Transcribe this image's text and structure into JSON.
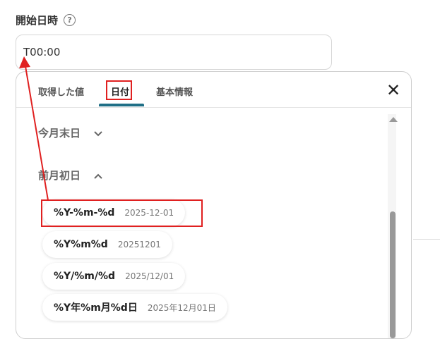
{
  "field": {
    "label": "開始日時",
    "help_icon": "?",
    "value": "T00:00"
  },
  "tabs": [
    {
      "label": "取得した値"
    },
    {
      "label": "日付"
    },
    {
      "label": "基本情報"
    }
  ],
  "active_tab": "日付",
  "close_icon": "✕",
  "sections": [
    {
      "label": "今月末日",
      "chevron": "⌄"
    },
    {
      "label": "前月初日",
      "chevron": "⌃"
    }
  ],
  "formats": [
    {
      "format": "%Y-%m-%d",
      "example": "2025-12-01"
    },
    {
      "format": "%Y%m%d",
      "example": "20251201"
    },
    {
      "format": "%Y/%m/%d",
      "example": "2025/12/01"
    },
    {
      "format": "%Y年%m月%d日",
      "example": "2025年12月01日"
    }
  ],
  "colors": {
    "accent": "#1f6f86",
    "highlight": "#e02020"
  }
}
